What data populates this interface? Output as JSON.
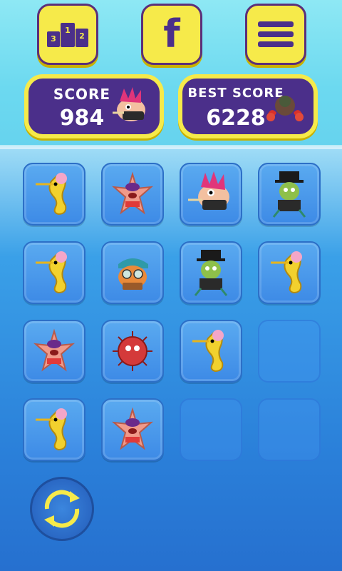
{
  "top_buttons": [
    {
      "name": "leaderboard",
      "icon": "podium-icon"
    },
    {
      "name": "facebook",
      "icon": "facebook-icon",
      "glyph": "f"
    },
    {
      "name": "menu",
      "icon": "hamburger-menu-icon"
    }
  ],
  "podium": {
    "ranks": [
      "3",
      "1",
      "2"
    ]
  },
  "score": {
    "label": "SCORE",
    "value": "984",
    "avatar": "punk-fish-icon"
  },
  "best_score": {
    "label": "BEST SCORE",
    "value": "6228",
    "avatar": "crab-icon"
  },
  "colors": {
    "accent": "#f6ea4a",
    "panel": "#4b2f8a",
    "outline": "#5b2f7a"
  },
  "grid": {
    "rows": [
      [
        "seahorse",
        "starfish",
        "punk-fish",
        "zombie"
      ],
      [
        "seahorse",
        "cap-fish",
        "zombie",
        "seahorse"
      ],
      [
        "starfish",
        "pufferfish",
        "seahorse",
        "empty"
      ],
      [
        "seahorse",
        "starfish",
        "empty",
        "empty"
      ]
    ]
  },
  "refresh": {
    "icon": "refresh-icon"
  }
}
